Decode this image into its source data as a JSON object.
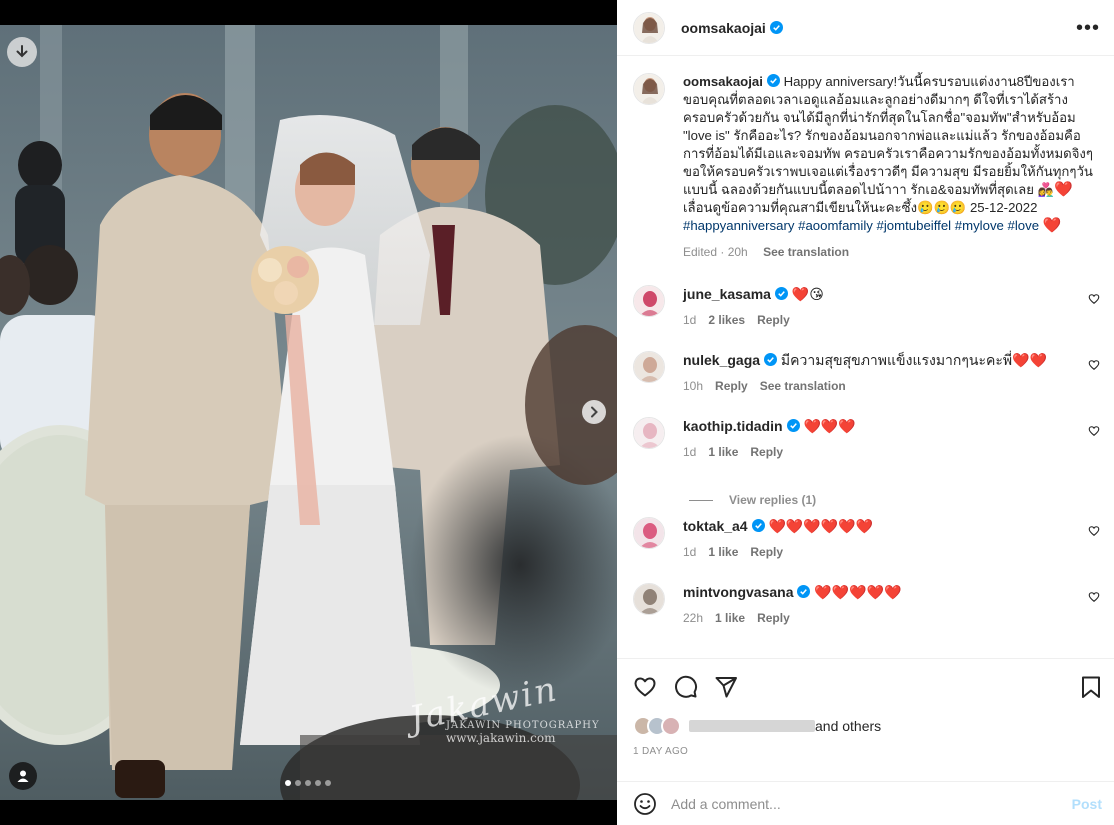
{
  "post": {
    "author": "oomsakaojai",
    "more_icon": "more-horizontal-icon",
    "photo_dots": [
      true,
      false,
      false,
      false,
      false
    ],
    "watermark": {
      "signature": "Jakawin",
      "line1": "JAKAWIN PHOTOGRAPHY",
      "line2": "www.jakawin.com"
    }
  },
  "caption": {
    "author": "oomsakaojai",
    "text_line1": " Happy anniversary!วันนี้ครบรอบแต่งงาน8ปีของเรา ขอบคุณที่ตลอดเวลาเอดูแลอ้อมและลูกอย่างดีมากๆ ดีใจที่เราได้สร้างครอบครัวด้วยกัน จนได้มีลูกที่น่ารักที่สุดในโลกชื่อ\"จอมทัพ\"สำหรับอ้อม \"love is\" รักคืออะไร? รักของอ้อมนอกจากพ่อและแม่แล้ว รักของอ้อมคือการที่อ้อมได้มีเอและจอมทัพ ครอบครัวเราคือความรักของอ้อมทั้งหมดจิงๆ ขอให้ครอบครัวเราพบเจอแต่เรื่องราวดีๆ มีความสุข มีรอยยิ้มให้กันทุกๆวันแบบนี้ ฉลองด้วยกันแบบนี้ตลอดไปน้าาา รักเอ&จอมทัพที่สุดเลย ",
    "emoji_couple": "👩‍❤️‍👨",
    "text_line2": " เลื่อนดูข้อความที่คุณสามีเขียนให้นะคะซึ้ง🥲🥲🥲 25-12-2022",
    "hashtags": [
      "#happyanniversary",
      "#aoomfamily",
      "#jomtubeiffel",
      "#mylove",
      "#love"
    ],
    "edited": "Edited · 20h",
    "see_translation": "See translation"
  },
  "comments": [
    {
      "user": "june_kasama",
      "text": "❤️😘",
      "time": "1d",
      "likes": "2 likes",
      "reply": "Reply",
      "extra": ""
    },
    {
      "user": "nulek_gaga",
      "text": "มีความสุขสุขภาพแข็งแรงมากๆนะคะพี่❤️❤️",
      "time": "10h",
      "likes": "",
      "reply": "Reply",
      "extra": "See translation"
    },
    {
      "user": "kaothip.tidadin",
      "text": "❤️❤️❤️",
      "time": "1d",
      "likes": "1 like",
      "reply": "Reply",
      "extra": ""
    },
    {
      "user": "toktak_a4",
      "text": "❤️❤️❤️❤️❤️❤️",
      "time": "1d",
      "likes": "1 like",
      "reply": "Reply",
      "extra": ""
    },
    {
      "user": "mintvongvasana",
      "text": "❤️❤️❤️❤️❤️",
      "time": "22h",
      "likes": "1 like",
      "reply": "Reply",
      "extra": ""
    }
  ],
  "view_replies": "View replies (1)",
  "likes_summary": "and others",
  "time_ago": "1 DAY AGO",
  "comment_input": {
    "placeholder": "Add a comment...",
    "post_label": "Post"
  },
  "colors": {
    "link": "#00376b",
    "verified": "#0095f6",
    "heart": "#ed4956",
    "post_disabled": "#b2dffc"
  }
}
